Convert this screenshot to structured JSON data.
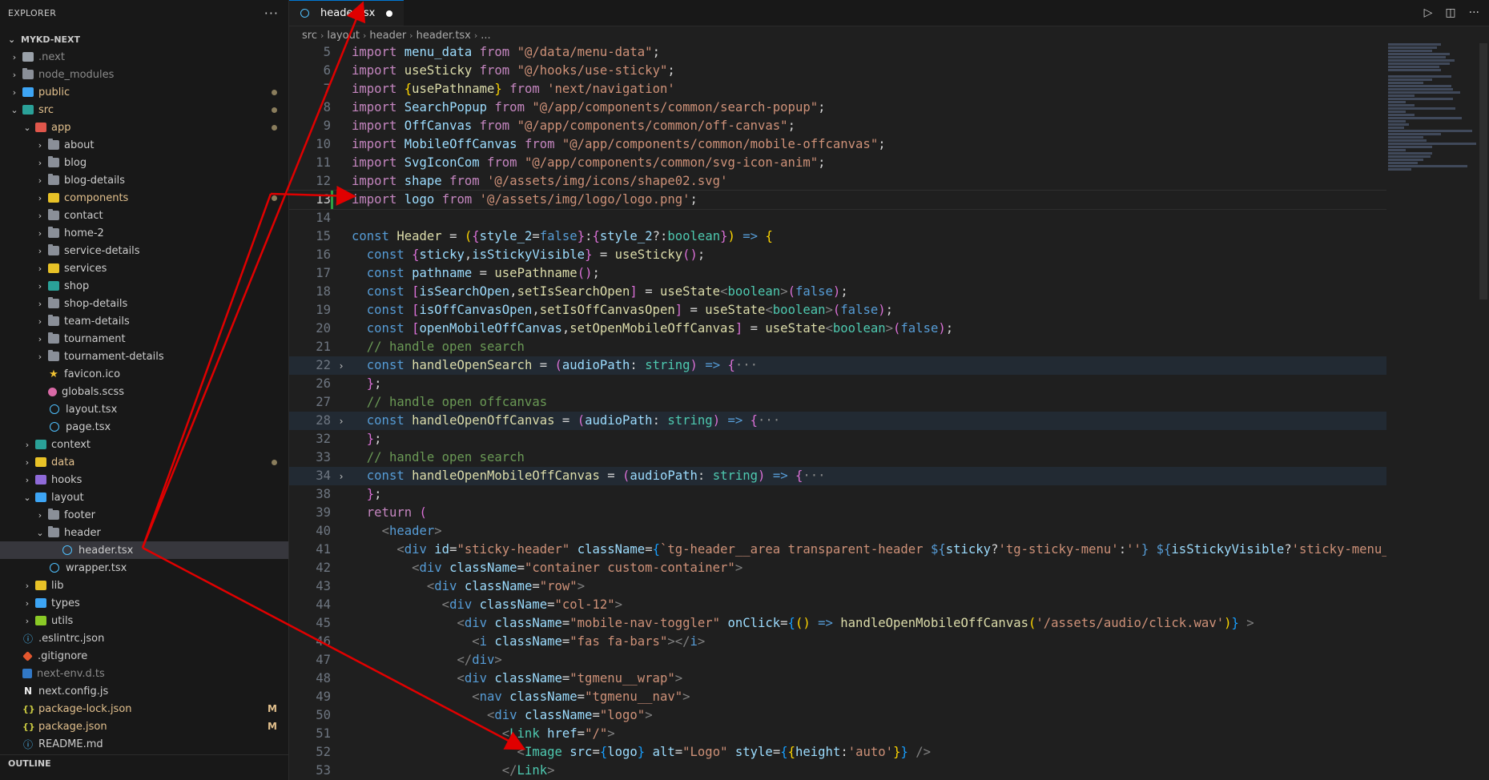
{
  "sidebar": {
    "title": "EXPLORER",
    "more": "···",
    "root": "MYKD-NEXT",
    "items": [
      {
        "label": "next",
        "prefix": ".",
        "depth": 0,
        "chev": "›",
        "icon": "gray",
        "dim": true
      },
      {
        "label": "node_modules",
        "depth": 0,
        "chev": "›",
        "icon": "folder",
        "dim": true
      },
      {
        "label": "public",
        "depth": 0,
        "chev": "›",
        "icon": "blue",
        "mod": true,
        "dot": true
      },
      {
        "label": "src",
        "depth": 0,
        "chev": "⌄",
        "icon": "teal",
        "mod": true,
        "dot": true
      },
      {
        "label": "app",
        "depth": 1,
        "chev": "⌄",
        "icon": "red",
        "mod": true,
        "dot": true
      },
      {
        "label": "about",
        "depth": 2,
        "chev": "›",
        "icon": "folder"
      },
      {
        "label": "blog",
        "depth": 2,
        "chev": "›",
        "icon": "folder"
      },
      {
        "label": "blog-details",
        "depth": 2,
        "chev": "›",
        "icon": "folder"
      },
      {
        "label": "components",
        "depth": 2,
        "chev": "›",
        "icon": "yellow",
        "mod": true,
        "dot": true
      },
      {
        "label": "contact",
        "depth": 2,
        "chev": "›",
        "icon": "folder"
      },
      {
        "label": "home-2",
        "depth": 2,
        "chev": "›",
        "icon": "folder"
      },
      {
        "label": "service-details",
        "depth": 2,
        "chev": "›",
        "icon": "folder"
      },
      {
        "label": "services",
        "depth": 2,
        "chev": "›",
        "icon": "yellow"
      },
      {
        "label": "shop",
        "depth": 2,
        "chev": "›",
        "icon": "teal"
      },
      {
        "label": "shop-details",
        "depth": 2,
        "chev": "›",
        "icon": "folder"
      },
      {
        "label": "team-details",
        "depth": 2,
        "chev": "›",
        "icon": "folder"
      },
      {
        "label": "tournament",
        "depth": 2,
        "chev": "›",
        "icon": "folder"
      },
      {
        "label": "tournament-details",
        "depth": 2,
        "chev": "›",
        "icon": "folder"
      },
      {
        "label": "favicon.ico",
        "depth": 2,
        "chev": "",
        "icon": "star"
      },
      {
        "label": "globals.scss",
        "depth": 2,
        "chev": "",
        "icon": "sass"
      },
      {
        "label": "layout.tsx",
        "depth": 2,
        "chev": "",
        "icon": "react"
      },
      {
        "label": "page.tsx",
        "depth": 2,
        "chev": "",
        "icon": "react"
      },
      {
        "label": "context",
        "depth": 1,
        "chev": "›",
        "icon": "teal"
      },
      {
        "label": "data",
        "depth": 1,
        "chev": "›",
        "icon": "yellow",
        "mod": true,
        "dot": true
      },
      {
        "label": "hooks",
        "depth": 1,
        "chev": "›",
        "icon": "purple"
      },
      {
        "label": "layout",
        "depth": 1,
        "chev": "⌄",
        "icon": "blue"
      },
      {
        "label": "footer",
        "depth": 2,
        "chev": "›",
        "icon": "folder"
      },
      {
        "label": "header",
        "depth": 2,
        "chev": "⌄",
        "icon": "folder"
      },
      {
        "label": "header.tsx",
        "depth": 3,
        "chev": "",
        "icon": "react",
        "active": true
      },
      {
        "label": "wrapper.tsx",
        "depth": 2,
        "chev": "",
        "icon": "react"
      },
      {
        "label": "lib",
        "depth": 1,
        "chev": "›",
        "icon": "yellow"
      },
      {
        "label": "types",
        "depth": 1,
        "chev": "›",
        "icon": "blue"
      },
      {
        "label": "utils",
        "depth": 1,
        "chev": "›",
        "icon": "green"
      },
      {
        "label": ".eslintrc.json",
        "depth": 0,
        "chev": "",
        "icon": "info"
      },
      {
        "label": ".gitignore",
        "depth": 0,
        "chev": "",
        "icon": "git"
      },
      {
        "label": "next-env.d.ts",
        "depth": 0,
        "chev": "",
        "icon": "ts",
        "dim": true
      },
      {
        "label": "next.config.js",
        "depth": 0,
        "chev": "",
        "icon": "n"
      },
      {
        "label": "package-lock.json",
        "depth": 0,
        "chev": "",
        "icon": "json",
        "mod": true,
        "badge": "M"
      },
      {
        "label": "package.json",
        "depth": 0,
        "chev": "",
        "icon": "json",
        "mod": true,
        "badge": "M"
      },
      {
        "label": "README.md",
        "depth": 0,
        "chev": "",
        "icon": "info"
      }
    ],
    "outline": "OUTLINE"
  },
  "tab": {
    "label": "header.tsx"
  },
  "breadcrumb": [
    "src",
    "layout",
    "header",
    "header.tsx",
    "..."
  ],
  "code_lines": [
    {
      "n": "5",
      "html": "<span class='kw'>import</span> <span class='vr'>menu_data</span> <span class='kw'>from</span> <span class='st'>\"@/data/menu-data\"</span><span class='pn'>;</span>"
    },
    {
      "n": "6",
      "html": "<span class='kw'>import</span> <span class='fn'>useSticky</span> <span class='kw'>from</span> <span class='st'>\"@/hooks/use-sticky\"</span><span class='pn'>;</span>"
    },
    {
      "n": "7",
      "html": "<span class='kw'>import</span> <span class='br1'>{</span><span class='fn'>usePathname</span><span class='br1'>}</span> <span class='kw'>from</span> <span class='st'>'next/navigation'</span>"
    },
    {
      "n": "8",
      "html": "<span class='kw'>import</span> <span class='vr'>SearchPopup</span> <span class='kw'>from</span> <span class='st'>\"@/app/components/common/search-popup\"</span><span class='pn'>;</span>"
    },
    {
      "n": "9",
      "html": "<span class='kw'>import</span> <span class='vr'>OffCanvas</span> <span class='kw'>from</span> <span class='st'>\"@/app/components/common/off-canvas\"</span><span class='pn'>;</span>"
    },
    {
      "n": "10",
      "html": "<span class='kw'>import</span> <span class='vr'>MobileOffCanvas</span> <span class='kw'>from</span> <span class='st'>\"@/app/components/common/mobile-offcanvas\"</span><span class='pn'>;</span>"
    },
    {
      "n": "11",
      "html": "<span class='kw'>import</span> <span class='vr'>SvgIconCom</span> <span class='kw'>from</span> <span class='st'>\"@/app/components/common/svg-icon-anim\"</span><span class='pn'>;</span>"
    },
    {
      "n": "12",
      "html": "<span class='kw'>import</span> <span class='vr'>shape</span> <span class='kw'>from</span> <span class='st'>'@/assets/img/icons/shape02.svg'</span>"
    },
    {
      "n": "13",
      "cur": true,
      "git": true,
      "html": "<span class='kw'>import</span> <span class='vr'>logo</span> <span class='kw'>from</span> <span class='st'>'@/assets/img/logo/logo.png'</span><span class='pn'>;</span>"
    },
    {
      "n": "14",
      "html": ""
    },
    {
      "n": "15",
      "html": "<span class='kb'>const</span> <span class='fn'>Header</span> <span class='pn'>=</span> <span class='br1'>(</span><span class='br2'>{</span><span class='vr'>style_2</span><span class='pn'>=</span><span class='kb'>false</span><span class='br2'>}</span><span class='pn'>:</span><span class='br2'>{</span><span class='vr'>style_2</span><span class='pn'>?:</span><span class='ty'>boolean</span><span class='br2'>}</span><span class='br1'>)</span> <span class='kb'>=&gt;</span> <span class='br1'>{</span>"
    },
    {
      "n": "16",
      "html": "  <span class='kb'>const</span> <span class='br2'>{</span><span class='vr'>sticky</span><span class='pn'>,</span><span class='vr'>isStickyVisible</span><span class='br2'>}</span> <span class='pn'>=</span> <span class='fn'>useSticky</span><span class='br2'>()</span><span class='pn'>;</span>"
    },
    {
      "n": "17",
      "html": "  <span class='kb'>const</span> <span class='vr'>pathname</span> <span class='pn'>=</span> <span class='fn'>usePathname</span><span class='br2'>()</span><span class='pn'>;</span>"
    },
    {
      "n": "18",
      "html": "  <span class='kb'>const</span> <span class='br2'>[</span><span class='vr'>isSearchOpen</span><span class='pn'>,</span><span class='fn'>setIsSearchOpen</span><span class='br2'>]</span> <span class='pn'>=</span> <span class='fn'>useState</span><span class='gr'>&lt;</span><span class='ty'>boolean</span><span class='gr'>&gt;</span><span class='br2'>(</span><span class='kb'>false</span><span class='br2'>)</span><span class='pn'>;</span>"
    },
    {
      "n": "19",
      "html": "  <span class='kb'>const</span> <span class='br2'>[</span><span class='vr'>isOffCanvasOpen</span><span class='pn'>,</span><span class='fn'>setIsOffCanvasOpen</span><span class='br2'>]</span> <span class='pn'>=</span> <span class='fn'>useState</span><span class='gr'>&lt;</span><span class='ty'>boolean</span><span class='gr'>&gt;</span><span class='br2'>(</span><span class='kb'>false</span><span class='br2'>)</span><span class='pn'>;</span>"
    },
    {
      "n": "20",
      "html": "  <span class='kb'>const</span> <span class='br2'>[</span><span class='vr'>openMobileOffCanvas</span><span class='pn'>,</span><span class='fn'>setOpenMobileOffCanvas</span><span class='br2'>]</span> <span class='pn'>=</span> <span class='fn'>useState</span><span class='gr'>&lt;</span><span class='ty'>boolean</span><span class='gr'>&gt;</span><span class='br2'>(</span><span class='kb'>false</span><span class='br2'>)</span><span class='pn'>;</span>"
    },
    {
      "n": "21",
      "html": "  <span class='cm'>// handle open search</span>"
    },
    {
      "n": "22",
      "fold": true,
      "hl": true,
      "html": "  <span class='kb'>const</span> <span class='fn'>handleOpenSearch</span> <span class='pn'>=</span> <span class='br2'>(</span><span class='vr'>audioPath</span><span class='pn'>:</span> <span class='ty'>string</span><span class='br2'>)</span> <span class='kb'>=&gt;</span> <span class='br2'>{</span><span class='fold'>···</span>"
    },
    {
      "n": "26",
      "html": "  <span class='br2'>}</span><span class='pn'>;</span>"
    },
    {
      "n": "27",
      "html": "  <span class='cm'>// handle open offcanvas</span>"
    },
    {
      "n": "28",
      "fold": true,
      "hl": true,
      "html": "  <span class='kb'>const</span> <span class='fn'>handleOpenOffCanvas</span> <span class='pn'>=</span> <span class='br2'>(</span><span class='vr'>audioPath</span><span class='pn'>:</span> <span class='ty'>string</span><span class='br2'>)</span> <span class='kb'>=&gt;</span> <span class='br2'>{</span><span class='fold'>···</span>"
    },
    {
      "n": "32",
      "html": "  <span class='br2'>}</span><span class='pn'>;</span>"
    },
    {
      "n": "33",
      "html": "  <span class='cm'>// handle open search</span>"
    },
    {
      "n": "34",
      "fold": true,
      "hl": true,
      "html": "  <span class='kb'>const</span> <span class='fn'>handleOpenMobileOffCanvas</span> <span class='pn'>=</span> <span class='br2'>(</span><span class='vr'>audioPath</span><span class='pn'>:</span> <span class='ty'>string</span><span class='br2'>)</span> <span class='kb'>=&gt;</span> <span class='br2'>{</span><span class='fold'>···</span>"
    },
    {
      "n": "38",
      "html": "  <span class='br2'>}</span><span class='pn'>;</span>"
    },
    {
      "n": "39",
      "html": "  <span class='kw'>return</span> <span class='br2'>(</span>"
    },
    {
      "n": "40",
      "html": "    <span class='gr'>&lt;</span><span class='tg'>header</span><span class='gr'>&gt;</span>"
    },
    {
      "n": "41",
      "html": "      <span class='gr'>&lt;</span><span class='tg'>div</span> <span class='at'>id</span><span class='pn'>=</span><span class='st'>\"sticky-header\"</span> <span class='at'>className</span><span class='pn'>=</span><span class='br3'>{</span><span class='st'>`tg-header__area transparent-header </span><span class='kb'>${</span><span class='vr'>sticky</span><span class='pn'>?</span><span class='st'>'tg-sticky-menu'</span><span class='pn'>:</span><span class='st'>''</span><span class='kb'>}</span> <span class='kb'>${</span><span class='vr'>isStickyVisible</span><span class='pn'>?</span><span class='st'>'sticky-menu_</span>"
    },
    {
      "n": "42",
      "html": "        <span class='gr'>&lt;</span><span class='tg'>div</span> <span class='at'>className</span><span class='pn'>=</span><span class='st'>\"container custom-container\"</span><span class='gr'>&gt;</span>"
    },
    {
      "n": "43",
      "html": "          <span class='gr'>&lt;</span><span class='tg'>div</span> <span class='at'>className</span><span class='pn'>=</span><span class='st'>\"row\"</span><span class='gr'>&gt;</span>"
    },
    {
      "n": "44",
      "html": "            <span class='gr'>&lt;</span><span class='tg'>div</span> <span class='at'>className</span><span class='pn'>=</span><span class='st'>\"col-12\"</span><span class='gr'>&gt;</span>"
    },
    {
      "n": "45",
      "html": "              <span class='gr'>&lt;</span><span class='tg'>div</span> <span class='at'>className</span><span class='pn'>=</span><span class='st'>\"mobile-nav-toggler\"</span> <span class='at'>onClick</span><span class='pn'>=</span><span class='br3'>{</span><span class='br1'>()</span> <span class='kb'>=&gt;</span> <span class='fn'>handleOpenMobileOffCanvas</span><span class='br1'>(</span><span class='st'>'/assets/audio/click.wav'</span><span class='br1'>)</span><span class='br3'>}</span> <span class='gr'>&gt;</span>"
    },
    {
      "n": "46",
      "html": "                <span class='gr'>&lt;</span><span class='tg'>i</span> <span class='at'>className</span><span class='pn'>=</span><span class='st'>\"fas fa-bars\"</span><span class='gr'>&gt;&lt;/</span><span class='tg'>i</span><span class='gr'>&gt;</span>"
    },
    {
      "n": "47",
      "html": "              <span class='gr'>&lt;/</span><span class='tg'>div</span><span class='gr'>&gt;</span>"
    },
    {
      "n": "48",
      "html": "              <span class='gr'>&lt;</span><span class='tg'>div</span> <span class='at'>className</span><span class='pn'>=</span><span class='st'>\"tgmenu__wrap\"</span><span class='gr'>&gt;</span>"
    },
    {
      "n": "49",
      "html": "                <span class='gr'>&lt;</span><span class='tg'>nav</span> <span class='at'>className</span><span class='pn'>=</span><span class='st'>\"tgmenu__nav\"</span><span class='gr'>&gt;</span>"
    },
    {
      "n": "50",
      "html": "                  <span class='gr'>&lt;</span><span class='tg'>div</span> <span class='at'>className</span><span class='pn'>=</span><span class='st'>\"logo\"</span><span class='gr'>&gt;</span>"
    },
    {
      "n": "51",
      "html": "                    <span class='gr'>&lt;</span><span class='ty'>Link</span> <span class='at'>href</span><span class='pn'>=</span><span class='st'>\"/\"</span><span class='gr'>&gt;</span>"
    },
    {
      "n": "52",
      "html": "                      <span class='gr'>&lt;</span><span class='ty'>Image</span> <span class='at'>src</span><span class='pn'>=</span><span class='br3'>{</span><span class='vr'>logo</span><span class='br3'>}</span> <span class='at'>alt</span><span class='pn'>=</span><span class='st'>\"Logo\"</span> <span class='at'>style</span><span class='pn'>=</span><span class='br3'>{</span><span class='br1'>{</span><span class='vr'>height</span><span class='pn'>:</span><span class='st'>'auto'</span><span class='br1'>}</span><span class='br3'>}</span> <span class='gr'>/&gt;</span>"
    },
    {
      "n": "53",
      "html": "                    <span class='gr'>&lt;/</span><span class='ty'>Link</span><span class='gr'>&gt;</span>"
    }
  ],
  "colors": {
    "accent": "#0078d4",
    "arrow": "#e00000",
    "modified": "#e2c08d"
  }
}
